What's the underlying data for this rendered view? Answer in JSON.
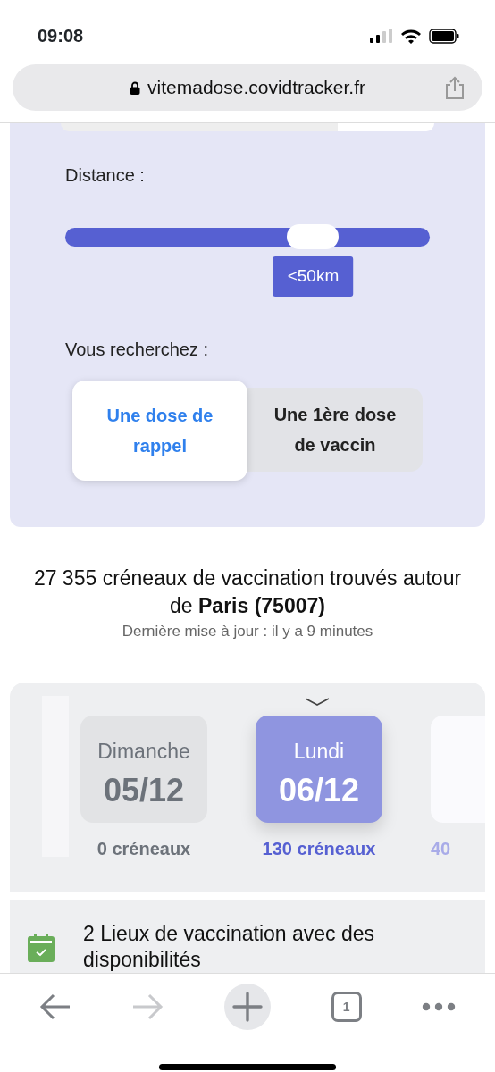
{
  "status_bar": {
    "time": "09:08"
  },
  "address_bar": {
    "url": "vitemadose.covidtracker.fr"
  },
  "search_panel": {
    "distance_label": "Distance :",
    "distance_slider": {
      "level": 0.68,
      "reading": "<50km"
    },
    "search_label": "Vous recherchez :",
    "options": [
      {
        "label": "Une dose de rappel",
        "selected": true
      },
      {
        "label": "Une 1ère dose de vaccin",
        "selected": false
      }
    ]
  },
  "results": {
    "count_line": "27 355 créneaux de vaccination trouvés autour de **Paris (75007)**",
    "updated": "Dernière mise à jour : il y a 9 minutes"
  },
  "days": [
    {
      "day": "Dimanche",
      "date": "05/12",
      "slots": "0 créneaux",
      "selected": false
    },
    {
      "day": "Lundi",
      "date": "06/12",
      "slots": "130 créneaux",
      "selected": true
    },
    {
      "slots": "40",
      "selected": false
    }
  ],
  "places": {
    "title": "2 Lieux de vaccination avec des disponibilités"
  },
  "toolbar": {
    "back_disabled": false,
    "forward_disabled": true,
    "tab_count": "1"
  }
}
